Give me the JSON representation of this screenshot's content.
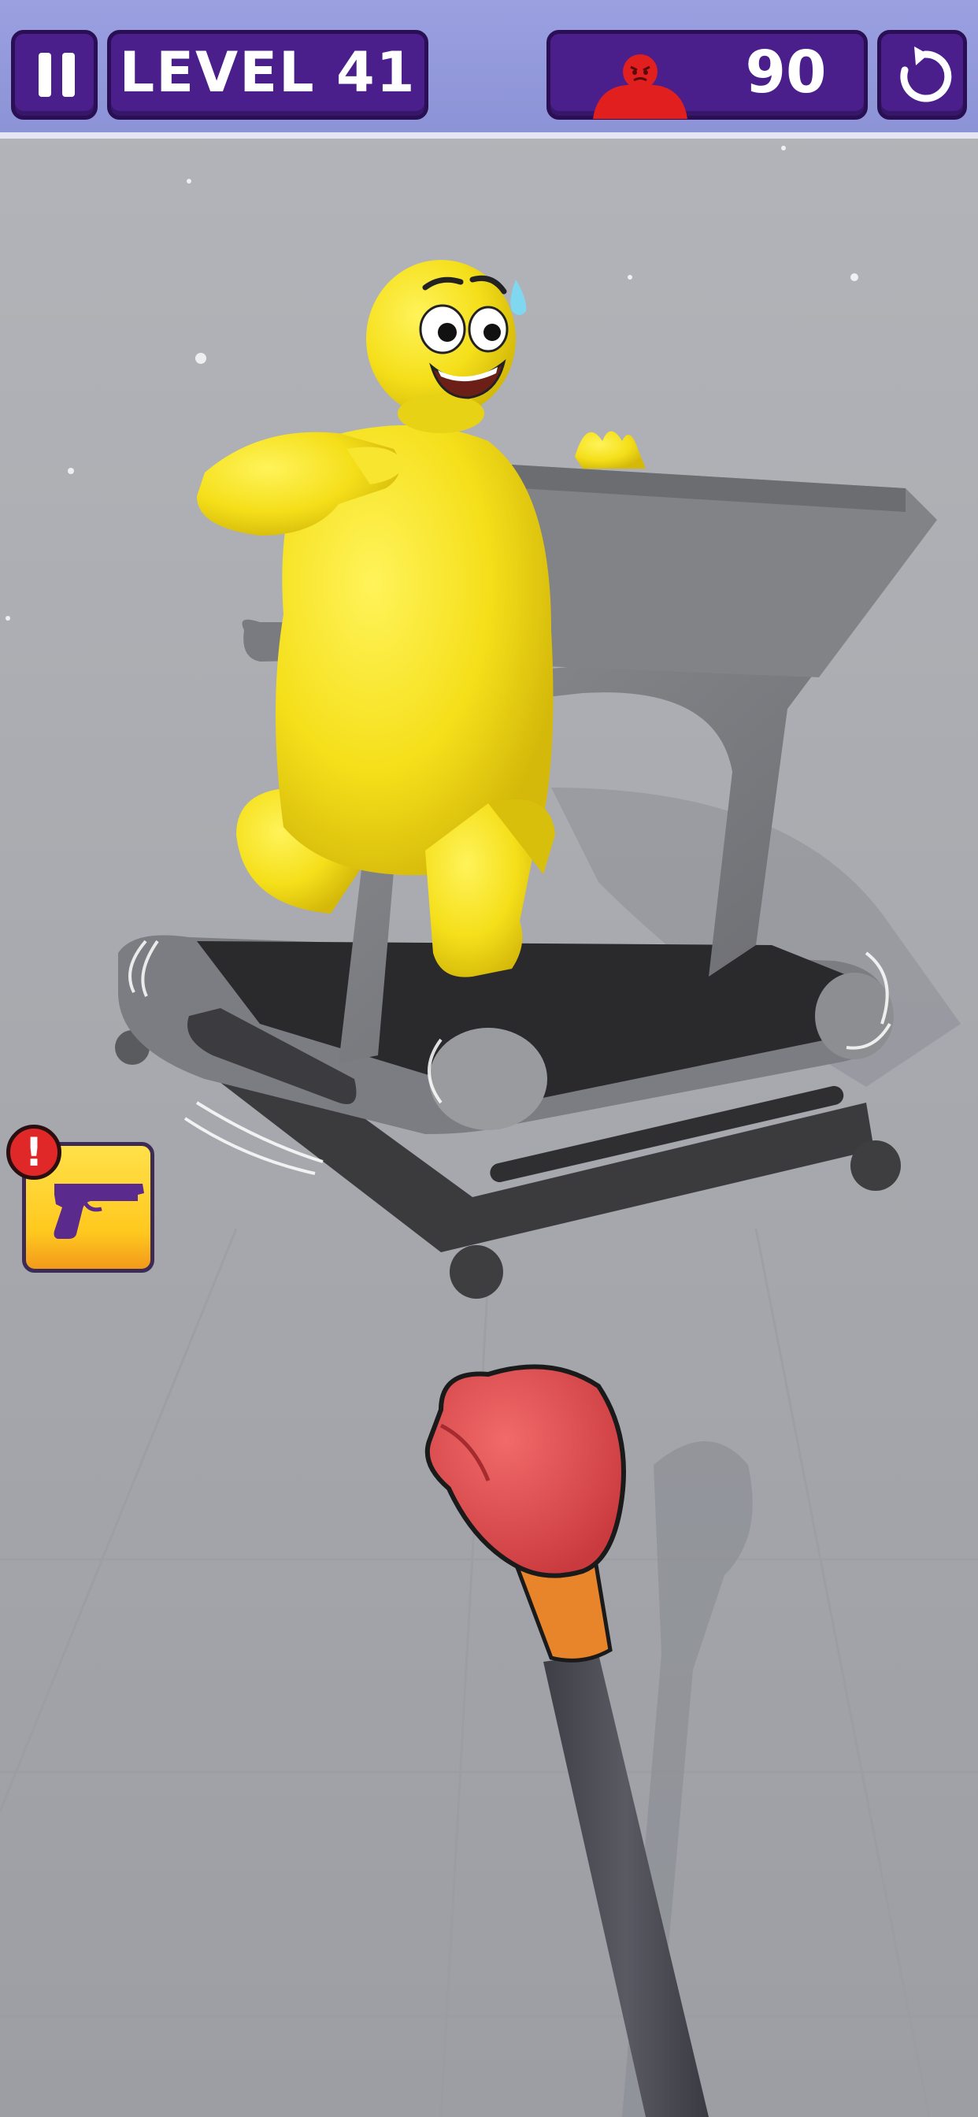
{
  "hud": {
    "level_label": "LEVEL 41",
    "enemies_remaining": "90",
    "pause_icon": "pause-icon",
    "restart_icon": "restart-icon",
    "enemy_icon": "angry-red-figure-icon"
  },
  "weapon_slot": {
    "icon": "pistol-icon",
    "alert": "!"
  },
  "scene": {
    "character": "yellow-blob-character",
    "equipment": "treadmill",
    "player_tool": "boxing-glove-on-stick"
  },
  "colors": {
    "hud_bar": "#9aa0e0",
    "hud_panel": "#4a1f8c",
    "character": "#f5e020",
    "glove": "#e84e50",
    "weapon_button": "#ffd02a",
    "alert": "#e02828"
  }
}
